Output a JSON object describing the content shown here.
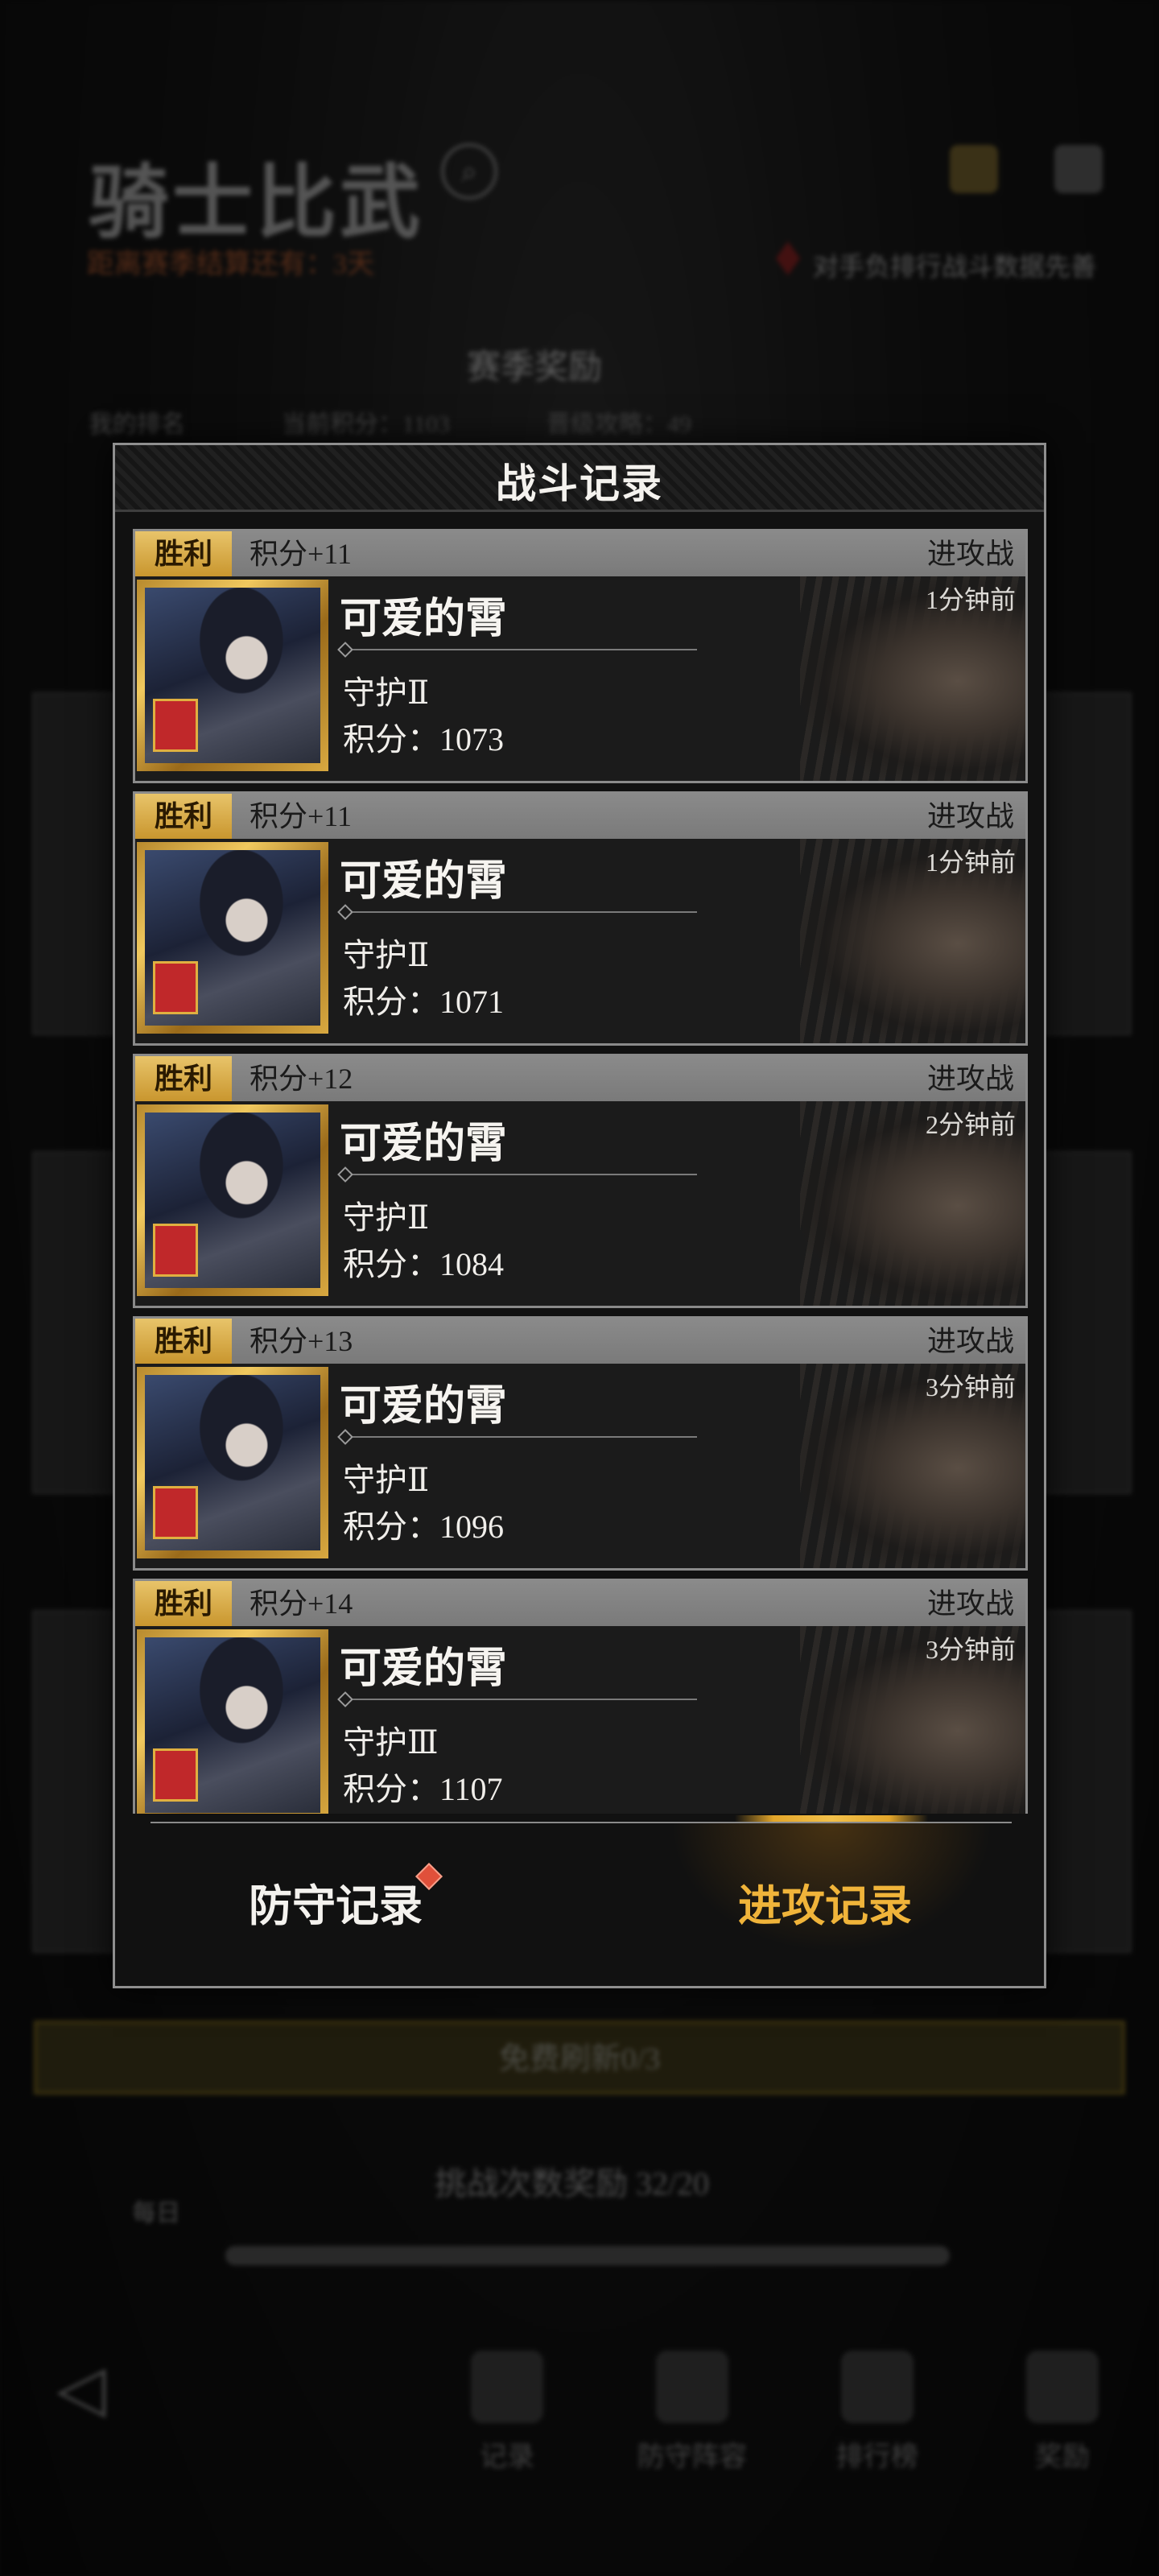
{
  "background": {
    "title": "骑士比武",
    "season_countdown": "距离赛季结算还有：3天",
    "right_note": "对手负排行战斗数据先善",
    "season_rewards_title": "赛季奖励",
    "season_stats": [
      "我的排名",
      "当前积分：1103",
      "晋级攻略：49"
    ],
    "refresh_button": "免费刷新0/3",
    "challenge_title": "挑战次数奖励 32/20",
    "daily_label": "每日",
    "nav": [
      "记录",
      "防守阵容",
      "排行榜",
      "奖励"
    ]
  },
  "modal": {
    "title": "战斗记录",
    "records": [
      {
        "result": "胜利",
        "score_change": "积分+11",
        "battle_type": "进攻战",
        "time": "1分钟前",
        "name": "可爱的霄",
        "rank": "守护Ⅱ",
        "points": "积分：1073"
      },
      {
        "result": "胜利",
        "score_change": "积分+11",
        "battle_type": "进攻战",
        "time": "1分钟前",
        "name": "可爱的霄",
        "rank": "守护Ⅱ",
        "points": "积分：1071"
      },
      {
        "result": "胜利",
        "score_change": "积分+12",
        "battle_type": "进攻战",
        "time": "2分钟前",
        "name": "可爱的霄",
        "rank": "守护Ⅱ",
        "points": "积分：1084"
      },
      {
        "result": "胜利",
        "score_change": "积分+13",
        "battle_type": "进攻战",
        "time": "3分钟前",
        "name": "可爱的霄",
        "rank": "守护Ⅱ",
        "points": "积分：1096"
      },
      {
        "result": "胜利",
        "score_change": "积分+14",
        "battle_type": "进攻战",
        "time": "3分钟前",
        "name": "可爱的霄",
        "rank": "守护Ⅲ",
        "points": "积分：1107"
      }
    ],
    "tabs": {
      "defense": "防守记录",
      "attack": "进攻记录",
      "active": "attack"
    }
  },
  "colors": {
    "win_badge": "#d7ad4a",
    "active_tab": "#f0b43a",
    "notification_dot": "#e0503a"
  }
}
